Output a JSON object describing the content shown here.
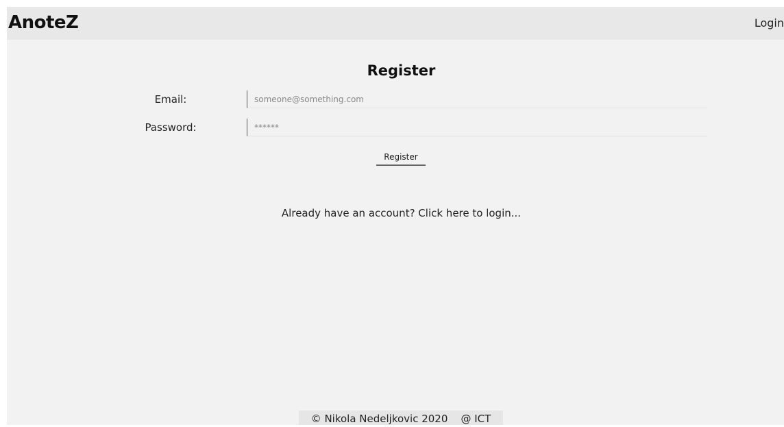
{
  "header": {
    "brand": "AnoteZ",
    "nav_login": "Login"
  },
  "register": {
    "heading": "Register",
    "email_label": "Email:",
    "email_placeholder": "someone@something.com",
    "password_label": "Password:",
    "password_placeholder": "******",
    "submit_label": "Register",
    "login_prompt": "Already have an account? Click here to login..."
  },
  "footer": {
    "text": "© Nikola Nedeljkovic 2020    @ ICT"
  }
}
